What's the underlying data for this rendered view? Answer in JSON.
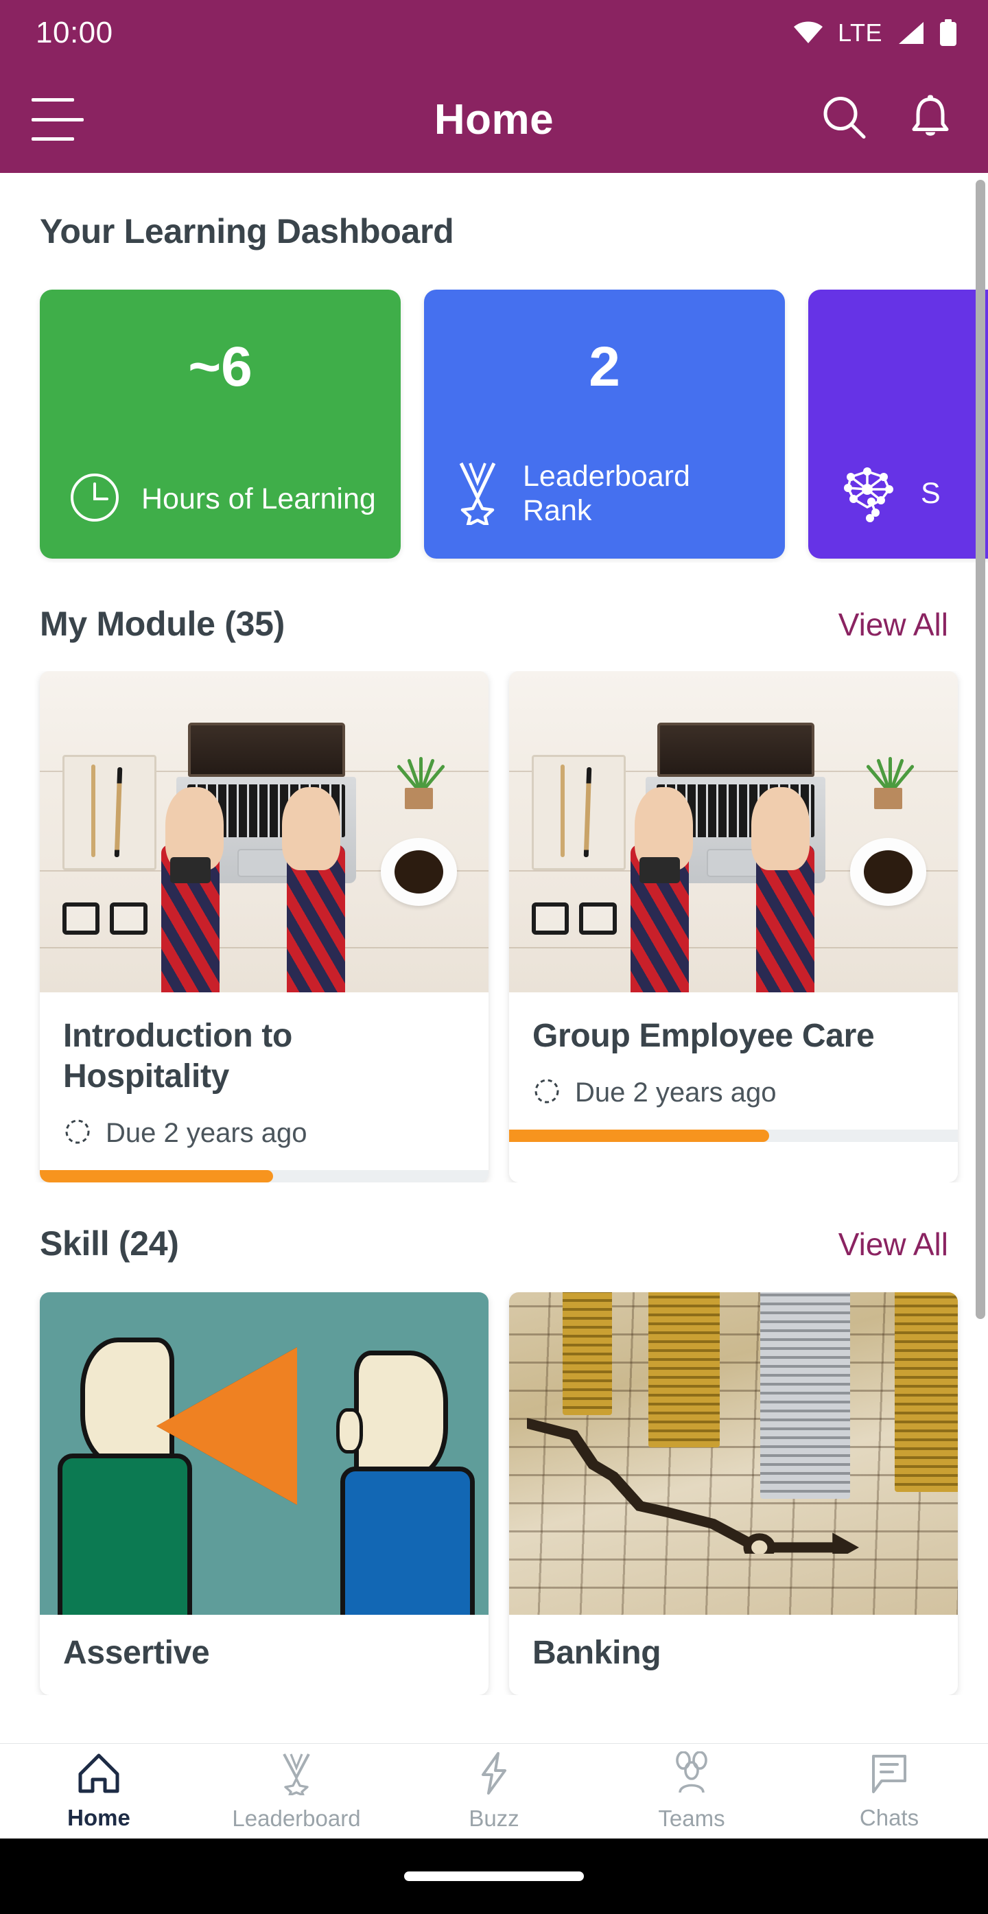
{
  "status_bar": {
    "time": "10:00",
    "network_label": "LTE",
    "icons": [
      "wifi-icon",
      "signal-icon",
      "battery-icon"
    ]
  },
  "app_bar": {
    "title": "Home",
    "menu_icon": "hamburger-menu-icon",
    "search_icon": "search-icon",
    "notification_icon": "bell-icon",
    "background_color": "#8a2361"
  },
  "dashboard": {
    "title": "Your Learning Dashboard",
    "stats": [
      {
        "value": "~6",
        "label": "Hours of Learning",
        "icon": "clock-icon",
        "color": "#3fae49"
      },
      {
        "value": "2",
        "label": "Leaderboard Rank",
        "icon": "medal-icon",
        "color": "#4570ef"
      },
      {
        "value": "",
        "label": "S",
        "icon": "skill-network-icon",
        "color": "#6633e6"
      }
    ]
  },
  "modules_section": {
    "title": "My Module (35)",
    "view_all_label": "View All",
    "cards": [
      {
        "name": "Introduction to Hospitality",
        "due": "Due 2 years ago",
        "due_icon": "dashed-circle-icon",
        "progress": 52,
        "progress_color": "#f7941e",
        "thumbnail": "desk-laptop-photo"
      },
      {
        "name": "Group Employee Care",
        "due": "Due 2 years ago",
        "due_icon": "dashed-circle-icon",
        "progress": 58,
        "progress_color": "#f7941e",
        "thumbnail": "desk-laptop-photo"
      }
    ]
  },
  "skills_section": {
    "title": "Skill (24)",
    "view_all_label": "View All",
    "cards": [
      {
        "name": "Assertive",
        "thumbnail": "megaphone-cartoon-illustration"
      },
      {
        "name": "Banking",
        "thumbnail": "coin-stacks-chart-photo"
      }
    ]
  },
  "bottom_nav": {
    "active_index": 0,
    "items": [
      {
        "label": "Home",
        "icon": "home-icon"
      },
      {
        "label": "Leaderboard",
        "icon": "medal-icon"
      },
      {
        "label": "Buzz",
        "icon": "lightning-bolt-icon"
      },
      {
        "label": "Teams",
        "icon": "people-group-icon"
      },
      {
        "label": "Chats",
        "icon": "chat-bubble-icon"
      }
    ]
  },
  "colors": {
    "brand": "#8a2361",
    "accent_orange": "#f7941e",
    "text_dark": "#3a444b",
    "text_muted": "#9aa3a9"
  }
}
